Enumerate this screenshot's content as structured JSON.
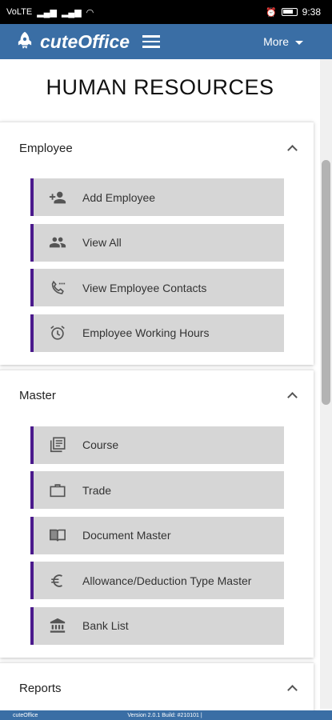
{
  "status_bar": {
    "network": "VoLTE",
    "signal_1": "4G",
    "signal_2": "4G",
    "time": "9:38"
  },
  "app_bar": {
    "title": "cuteOffice",
    "more_label": "More"
  },
  "page_title": "HUMAN RESOURCES",
  "sections": [
    {
      "title": "Employee",
      "items": [
        {
          "label": "Add Employee",
          "icon": "add-person-icon"
        },
        {
          "label": "View All",
          "icon": "people-icon"
        },
        {
          "label": "View Employee Contacts",
          "icon": "phone-icon"
        },
        {
          "label": "Employee Working Hours",
          "icon": "alarm-clock-icon"
        }
      ]
    },
    {
      "title": "Master",
      "items": [
        {
          "label": "Course",
          "icon": "library-books-icon"
        },
        {
          "label": "Trade",
          "icon": "briefcase-icon"
        },
        {
          "label": "Document Master",
          "icon": "book-icon"
        },
        {
          "label": "Allowance/Deduction Type Master",
          "icon": "euro-icon"
        },
        {
          "label": "Bank List",
          "icon": "bank-icon"
        }
      ]
    },
    {
      "title": "Reports",
      "items": []
    }
  ],
  "footer": {
    "app_name": "cuteOffice",
    "version": "Version 2.0.1 Build: #210101 |"
  },
  "colors": {
    "app_bar": "#3a6ea5",
    "item_accent": "#4b1a8c",
    "item_bg": "#d6d6d6"
  }
}
